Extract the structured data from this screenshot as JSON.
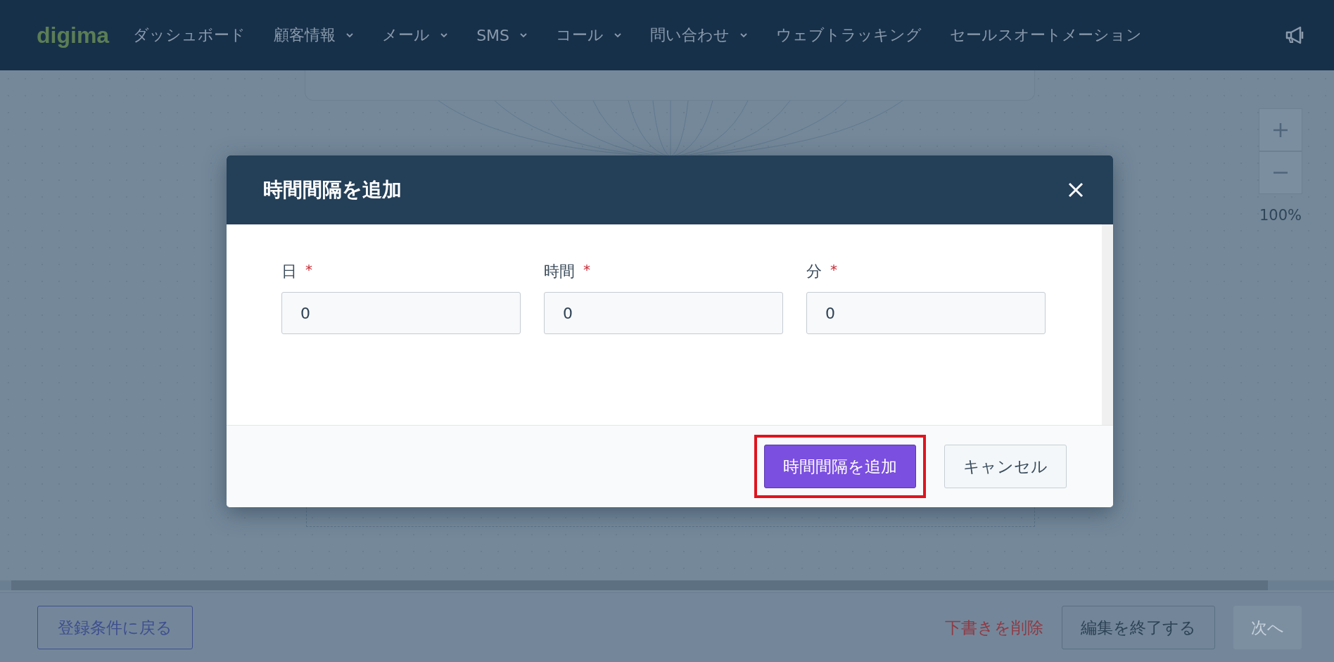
{
  "nav": {
    "logo": "digima",
    "items": [
      {
        "label": "ダッシュボード",
        "dropdown": false
      },
      {
        "label": "顧客情報",
        "dropdown": true
      },
      {
        "label": "メール",
        "dropdown": true
      },
      {
        "label": "SMS",
        "dropdown": true
      },
      {
        "label": "コール",
        "dropdown": true
      },
      {
        "label": "問い合わせ",
        "dropdown": true
      },
      {
        "label": "ウェブトラッキング",
        "dropdown": false
      },
      {
        "label": "セールスオートメーション",
        "dropdown": false
      }
    ]
  },
  "zoom": {
    "reading": "100%"
  },
  "modal": {
    "title": "時間間隔を追加",
    "fields": [
      {
        "label": "日",
        "required_mark": "*",
        "value": "0"
      },
      {
        "label": "時間",
        "required_mark": "*",
        "value": "0"
      },
      {
        "label": "分",
        "required_mark": "*",
        "value": "0"
      }
    ],
    "buttons": [
      {
        "label": "時間間隔を追加",
        "kind": "primary",
        "highlighted": true
      },
      {
        "label": "キャンセル",
        "kind": "secondary",
        "highlighted": false
      }
    ]
  },
  "bottom_bar": {
    "buttons": [
      {
        "label": "登録条件に戻る",
        "kind": "outline",
        "disabled": false
      },
      {
        "label": "下書きを削除",
        "kind": "danger-link",
        "disabled": false
      },
      {
        "label": "編集を終了する",
        "kind": "secondary",
        "disabled": false
      },
      {
        "label": "次へ",
        "kind": "primary",
        "disabled": true
      }
    ]
  }
}
